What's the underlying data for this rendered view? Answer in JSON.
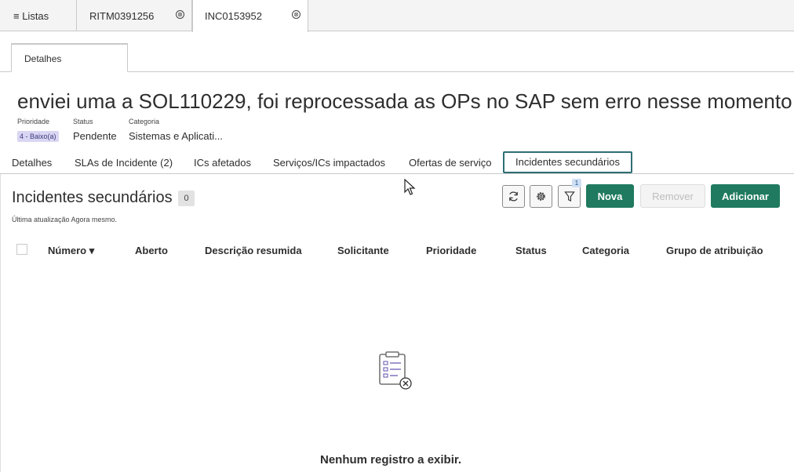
{
  "top_tabs": {
    "lists_label": "≡ Listas",
    "tab1": "RITM0391256",
    "tab2": "INC0153952",
    "close_symbol": "⊗"
  },
  "form_tab": "Detalhes",
  "record": {
    "title": "enviei uma a SOL110229, foi reprocessada as OPs no SAP sem erro nesse momento,",
    "priority_label": "Prioridade",
    "priority_value": "4 - Baixo(a)",
    "status_label": "Status",
    "status_value": "Pendente",
    "category_label": "Categoria",
    "category_value": "Sistemas e Aplicati..."
  },
  "related_tabs": [
    "Detalhes",
    "SLAs de Incidente (2)",
    "ICs afetados",
    "Serviços/ICs impactados",
    "Ofertas de serviço",
    "Incidentes secundários"
  ],
  "list": {
    "title": "Incidentes secundários",
    "count": "0",
    "last_update": "Última atualização Agora mesmo.",
    "filter_count": "1",
    "buttons": {
      "new": "Nova",
      "remove": "Remover",
      "add": "Adicionar"
    },
    "columns": [
      "Número ▾",
      "Aberto",
      "Descrição resumida",
      "Solicitante",
      "Prioridade",
      "Status",
      "Categoria",
      "Grupo de atribuição"
    ],
    "empty_message": "Nenhum registro a exibir."
  },
  "colors": {
    "primary_button": "#1f7a5f",
    "active_tab_border": "#2e6f74",
    "priority_badge": "#d9d6f4"
  }
}
